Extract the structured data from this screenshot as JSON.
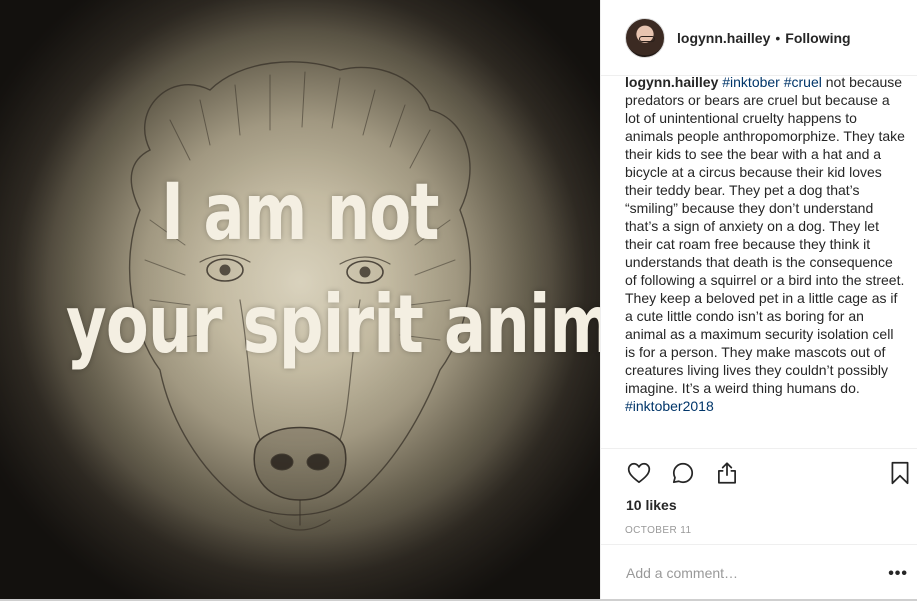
{
  "image": {
    "overlay_line1": "I am not",
    "overlay_line2": "your spirit animal"
  },
  "header": {
    "username": "logynn.hailley",
    "separator": "•",
    "follow_status": "Following"
  },
  "caption": {
    "username": "logynn.hailley",
    "tag1": "#inktober",
    "tag2": "#cruel",
    "body": " not because predators or bears are cruel but because a lot of unintentional cruelty happens to animals people anthropomorphize. They take their kids to see the bear with a hat and a bicycle at a circus because their kid loves their teddy bear. They pet a dog that’s “smiling” because they don’t understand that’s a sign of anxiety on a dog. They let their cat roam free because they think it understands that death is the consequence of following a squirrel or a bird into the street. They keep a beloved pet in a little cage as if a cute little condo isn’t as boring for an animal as a maximum security isolation cell is for a person. They make mascots out of creatures living lives they couldn’t possibly imagine. It’s a weird thing humans do.",
    "tag3": "#inktober2018"
  },
  "actions": {
    "like_icon": "heart-icon",
    "comment_icon": "comment-icon",
    "share_icon": "share-icon",
    "save_icon": "bookmark-icon"
  },
  "likes": "10 likes",
  "date": "OCTOBER 11",
  "comment": {
    "placeholder": "Add a comment…",
    "more": "•••"
  },
  "colors": {
    "text": "#262626",
    "hashtag": "#003569",
    "muted": "#999999",
    "divider": "#efefef"
  }
}
